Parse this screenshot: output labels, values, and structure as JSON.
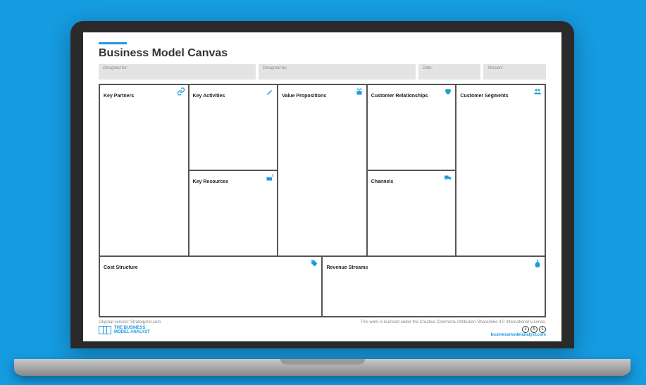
{
  "title": "Business Model Canvas",
  "meta": {
    "designed_for_label": "Designed for:",
    "designed_by_label": "Designed by:",
    "date_label": "Date:",
    "version_label": "Version:"
  },
  "sections": {
    "key_partners": "Key Partners",
    "key_activities": "Key Activities",
    "key_resources": "Key Resources",
    "value_propositions": "Value Propositions",
    "customer_relationships": "Customer Relationships",
    "channels": "Channels",
    "customer_segments": "Customer Segments",
    "cost_structure": "Cost Structure",
    "revenue_streams": "Revenue Streams"
  },
  "footer": {
    "original": "Original version: Strategyzer.com",
    "license": "This work is licensed under the Creative Commons Attribution-ShareAlike 4.0 International License.",
    "brand_line1": "THE BUSINESS",
    "brand_line2": "MODEL ANALYST",
    "website": "businessmodelanalyst.com"
  }
}
